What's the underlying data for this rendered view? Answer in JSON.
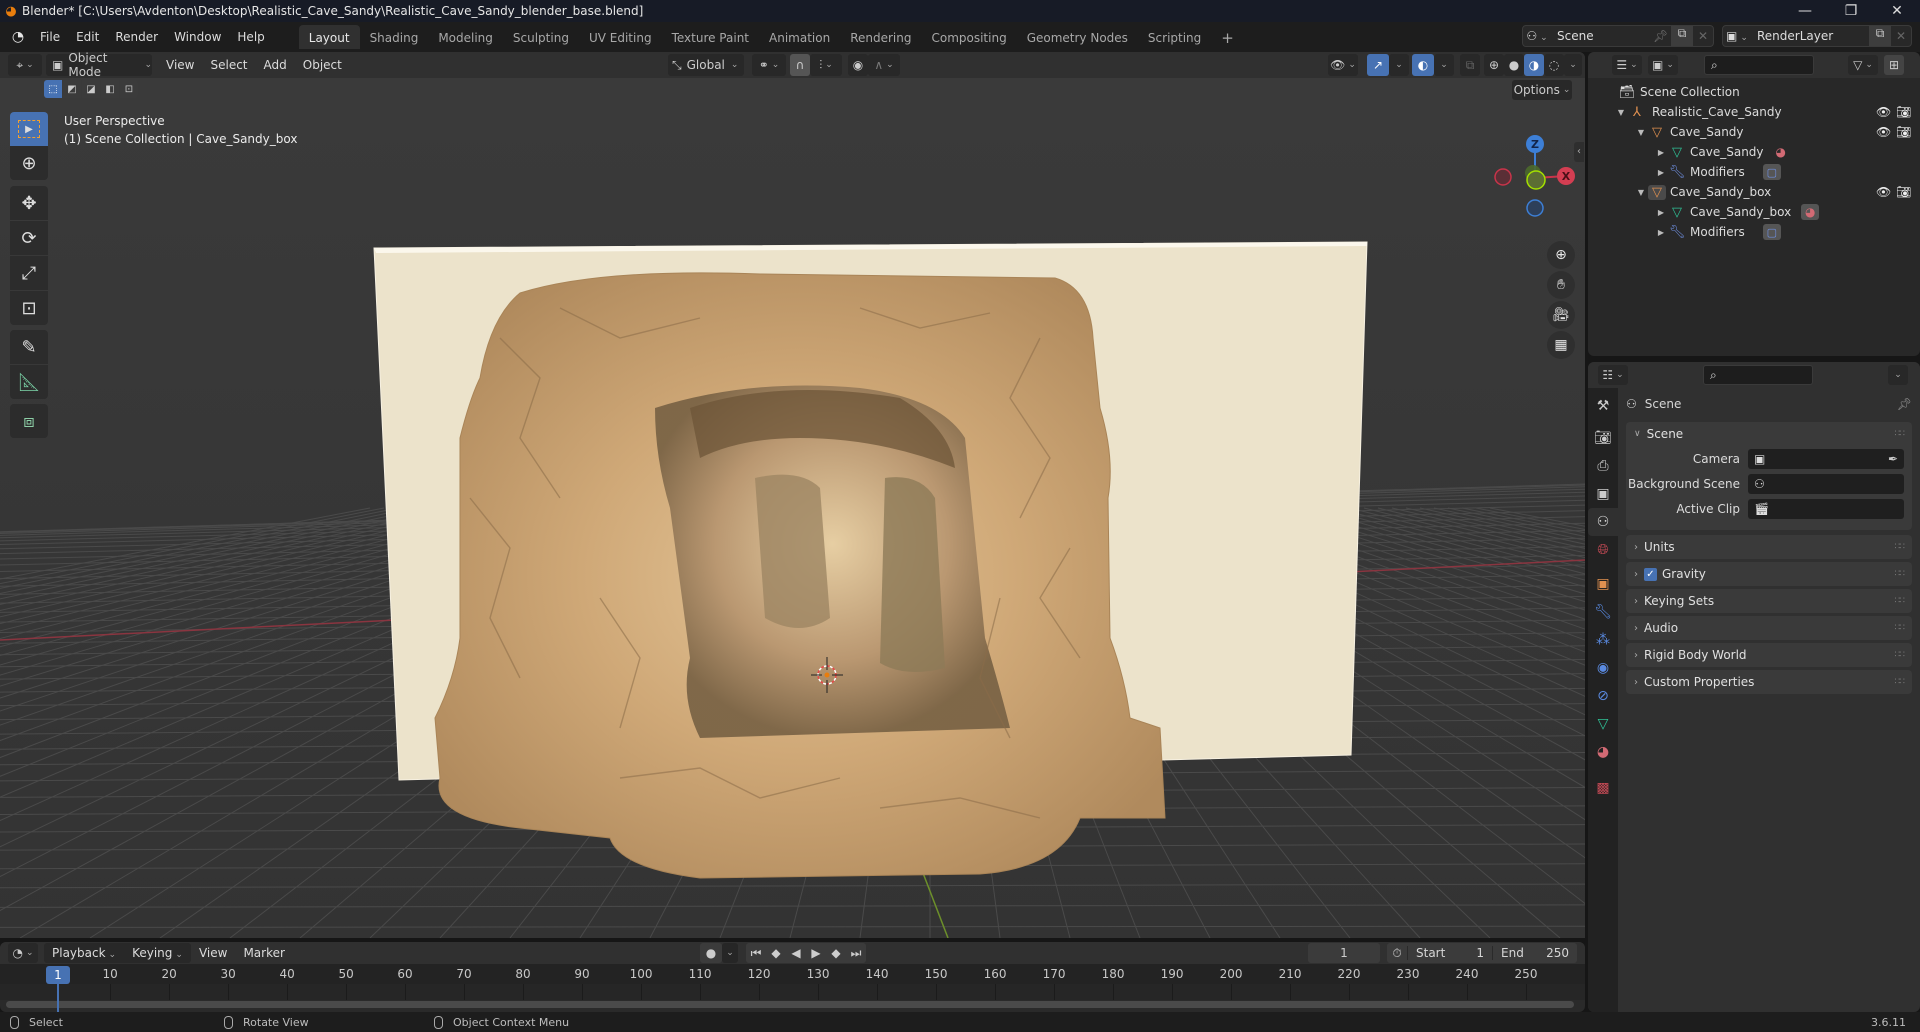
{
  "window": {
    "title": "Blender* [C:\\Users\\Avdenton\\Desktop\\Realistic_Cave_Sandy\\Realistic_Cave_Sandy_blender_base.blend]",
    "minimize": "—",
    "maximize": "❐",
    "close": "✕"
  },
  "menus": [
    "File",
    "Edit",
    "Render",
    "Window",
    "Help"
  ],
  "workspaces": [
    {
      "label": "Layout",
      "active": true
    },
    {
      "label": "Shading"
    },
    {
      "label": "Modeling"
    },
    {
      "label": "Sculpting"
    },
    {
      "label": "UV Editing"
    },
    {
      "label": "Texture Paint"
    },
    {
      "label": "Animation"
    },
    {
      "label": "Rendering"
    },
    {
      "label": "Compositing"
    },
    {
      "label": "Geometry Nodes"
    },
    {
      "label": "Scripting"
    }
  ],
  "add_workspace": "+",
  "scene_selector": {
    "value": "Scene"
  },
  "view_layer_selector": {
    "value": "RenderLayer"
  },
  "viewport": {
    "mode": "Object Mode",
    "menus": [
      "View",
      "Select",
      "Add",
      "Object"
    ],
    "orientation": "Global",
    "options_label": "Options",
    "overlay_line1": "User Perspective",
    "overlay_line2": "(1) Scene Collection | Cave_Sandy_box",
    "gizmo": {
      "z": "Z",
      "x": "X",
      "y": "Y"
    },
    "colors": {
      "x_axis": "#c9344a",
      "y_axis": "#7aa32a",
      "z_axis": "#3d7fd6",
      "accent": "#4772b3"
    }
  },
  "outliner": {
    "root": "Scene Collection",
    "items": [
      {
        "label": "Realistic_Cave_Sandy",
        "type": "empty",
        "depth": 0
      },
      {
        "label": "Cave_Sandy",
        "type": "mesh-object",
        "depth": 1
      },
      {
        "label": "Cave_Sandy",
        "type": "mesh-data",
        "depth": 2
      },
      {
        "label": "Modifiers",
        "type": "modifiers",
        "depth": 2
      },
      {
        "label": "Cave_Sandy_box",
        "type": "mesh-object",
        "depth": 1,
        "selected": true
      },
      {
        "label": "Cave_Sandy_box",
        "type": "mesh-data",
        "depth": 2
      },
      {
        "label": "Modifiers",
        "type": "modifiers",
        "depth": 2
      }
    ]
  },
  "properties": {
    "context_title": "Scene",
    "tabs": [
      "Tool",
      "Render",
      "Output",
      "View Layer",
      "Scene",
      "World",
      "Object",
      "Modifiers",
      "Particles",
      "Physics",
      "Object Constraints",
      "Data",
      "Material",
      "Texture"
    ],
    "active_tab": "Scene",
    "scene_panel": {
      "title": "Scene",
      "camera_label": "Camera",
      "camera_value": "",
      "background_scene_label": "Background Scene",
      "background_scene_value": "",
      "active_clip_label": "Active Clip",
      "active_clip_value": ""
    },
    "collapsed_panels": [
      {
        "label": "Units"
      },
      {
        "label": "Gravity",
        "checkbox": true,
        "checked": true
      },
      {
        "label": "Keying Sets"
      },
      {
        "label": "Audio"
      },
      {
        "label": "Rigid Body World"
      },
      {
        "label": "Custom Properties"
      }
    ]
  },
  "timeline": {
    "menus": [
      "Playback",
      "Keying",
      "View",
      "Marker"
    ],
    "current_frame": "1",
    "start_label": "Start",
    "start_value": "1",
    "end_label": "End",
    "end_value": "250",
    "ticks": [
      "10",
      "20",
      "30",
      "40",
      "50",
      "60",
      "70",
      "80",
      "90",
      "100",
      "110",
      "120",
      "130",
      "140",
      "150",
      "160",
      "170",
      "180",
      "190",
      "200",
      "210",
      "220",
      "230",
      "240",
      "250"
    ],
    "playhead_label": "1"
  },
  "statusbar": {
    "select": "Select",
    "rotate": "Rotate View",
    "context_menu": "Object Context Menu",
    "version": "3.6.11"
  }
}
